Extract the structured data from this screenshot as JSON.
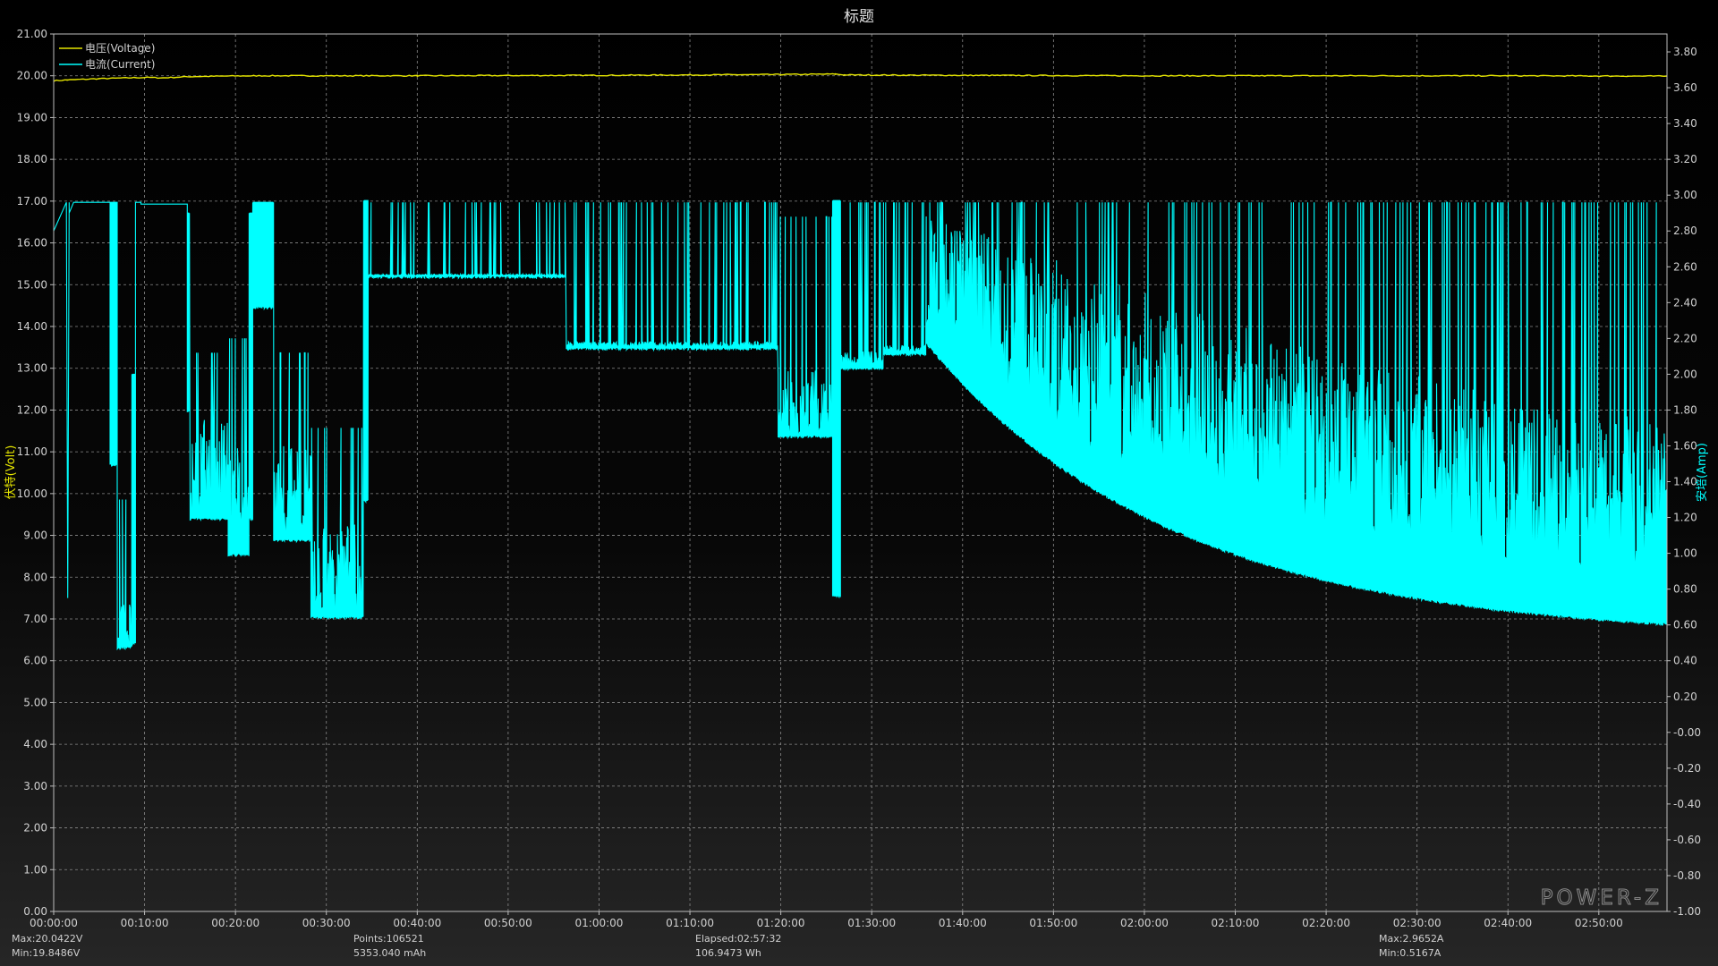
{
  "chart_data": {
    "type": "line",
    "title": "标题",
    "y_left_label": "伏特(Volt)",
    "y_right_label": "安培(Amp)",
    "y_left_range": [
      0,
      21
    ],
    "y_right_range": [
      -1.0,
      3.9
    ],
    "y_left_ticks": [
      "0.00",
      "1.00",
      "2.00",
      "3.00",
      "4.00",
      "5.00",
      "6.00",
      "7.00",
      "8.00",
      "9.00",
      "10.00",
      "11.00",
      "12.00",
      "13.00",
      "14.00",
      "15.00",
      "16.00",
      "17.00",
      "18.00",
      "19.00",
      "20.00",
      "21.00"
    ],
    "y_right_ticks": [
      "-1.00",
      "-0.80",
      "-0.60",
      "-0.40",
      "-0.20",
      "-0.00",
      "0.20",
      "0.40",
      "0.60",
      "0.80",
      "1.00",
      "1.20",
      "1.40",
      "1.60",
      "1.80",
      "2.00",
      "2.20",
      "2.40",
      "2.60",
      "2.80",
      "3.00",
      "3.20",
      "3.40",
      "3.60",
      "3.80"
    ],
    "x_ticks": [
      "00:00:00",
      "00:10:00",
      "00:20:00",
      "00:30:00",
      "00:40:00",
      "00:50:00",
      "01:00:00",
      "01:10:00",
      "01:20:00",
      "01:30:00",
      "01:40:00",
      "01:50:00",
      "02:00:00",
      "02:10:00",
      "02:20:00",
      "02:30:00",
      "02:40:00",
      "02:50:00"
    ],
    "x_range_minutes": [
      0,
      177.5
    ],
    "grid": true,
    "legend_position": "top-left",
    "series": [
      {
        "name": "电压(Voltage)",
        "axis": "left",
        "color": "#e6e600",
        "points": [
          [
            0,
            19.88
          ],
          [
            1.5,
            19.9
          ],
          [
            5,
            19.93
          ],
          [
            10,
            19.96
          ],
          [
            12,
            19.95
          ],
          [
            15,
            19.98
          ],
          [
            22,
            20.0
          ],
          [
            40,
            20.0
          ],
          [
            60,
            20.01
          ],
          [
            80,
            20.03
          ],
          [
            86,
            20.04
          ],
          [
            87,
            20.02
          ],
          [
            100,
            20.01
          ],
          [
            120,
            20.0
          ],
          [
            140,
            20.0
          ],
          [
            160,
            20.0
          ],
          [
            177.5,
            19.99
          ]
        ]
      },
      {
        "name": "电流(Current)",
        "axis": "right",
        "color": "#00ffff",
        "segments": [
          {
            "t0": 0,
            "t1": 1.4,
            "kind": "ramp",
            "v0": 2.8,
            "v1": 2.96
          },
          {
            "t0": 1.4,
            "t1": 1.7,
            "kind": "drop",
            "v0": 0.75
          },
          {
            "t0": 1.7,
            "t1": 2.2,
            "kind": "ramp",
            "v0": 2.9,
            "v1": 2.96
          },
          {
            "t0": 2.2,
            "t1": 6.2,
            "kind": "flat",
            "v": 2.96
          },
          {
            "t0": 6.2,
            "t1": 7,
            "kind": "band",
            "top": 2.96,
            "bot": 1.5,
            "spike": 0
          },
          {
            "t0": 7,
            "t1": 8.6,
            "kind": "band",
            "top": 1.3,
            "bot": 0.48,
            "spike": 0.3
          },
          {
            "t0": 8.6,
            "t1": 9.0,
            "kind": "band",
            "top": 2.0,
            "bot": 0.5,
            "spike": 0
          },
          {
            "t0": 9.0,
            "t1": 9.6,
            "kind": "flat",
            "v": 2.96
          },
          {
            "t0": 9.6,
            "t1": 14.7,
            "kind": "flat",
            "v": 2.95
          },
          {
            "t0": 14.7,
            "t1": 15.0,
            "kind": "band",
            "top": 2.9,
            "bot": 1.8,
            "spike": 0
          },
          {
            "t0": 15.0,
            "t1": 19.2,
            "kind": "band",
            "top": 2.12,
            "bot": 1.2,
            "spike": 0.6
          },
          {
            "t0": 19.2,
            "t1": 21.5,
            "kind": "band",
            "top": 2.2,
            "bot": 1.0,
            "spike": 0.5
          },
          {
            "t0": 21.5,
            "t1": 21.9,
            "kind": "band",
            "top": 2.9,
            "bot": 1.2,
            "spike": 0
          },
          {
            "t0": 21.9,
            "t1": 24.2,
            "kind": "band",
            "top": 2.96,
            "bot": 2.38,
            "spike": 0
          },
          {
            "t0": 24.2,
            "t1": 28.3,
            "kind": "band",
            "top": 2.12,
            "bot": 1.08,
            "spike": 0.5
          },
          {
            "t0": 28.3,
            "t1": 34.1,
            "kind": "band",
            "top": 1.7,
            "bot": 0.65,
            "spike": 0.5
          },
          {
            "t0": 34.1,
            "t1": 34.6,
            "kind": "band",
            "top": 2.97,
            "bot": 1.3,
            "spike": 0
          },
          {
            "t0": 34.6,
            "t1": 56.4,
            "kind": "band",
            "top": 2.96,
            "bot": 2.55,
            "spike": 0.02
          },
          {
            "t0": 56.4,
            "t1": 79.7,
            "kind": "band",
            "top": 2.96,
            "bot": 2.15,
            "spike": 0.04
          },
          {
            "t0": 79.7,
            "t1": 85.7,
            "kind": "band",
            "top": 2.88,
            "bot": 1.66,
            "spike": 0.3
          },
          {
            "t0": 85.7,
            "t1": 86.6,
            "kind": "band",
            "top": 2.97,
            "bot": 0.77,
            "spike": 0
          },
          {
            "t0": 86.6,
            "t1": 91.3,
            "kind": "band",
            "top": 2.96,
            "bot": 2.04,
            "spike": 0.1
          },
          {
            "t0": 91.3,
            "t1": 96.0,
            "kind": "band",
            "top": 2.96,
            "bot": 2.12,
            "spike": 0.05
          },
          {
            "t0": 96.0,
            "t1": 177.5,
            "kind": "decay",
            "top": 2.96,
            "bot_start": 2.18,
            "bot_end": 0.53,
            "spike": 0.9
          }
        ]
      }
    ]
  },
  "stats": {
    "voltage_max": "Max:20.0422V",
    "voltage_min": "Min:19.8486V",
    "points": "Points:106521",
    "capacity": "5353.040 mAh",
    "elapsed": "Elapsed:02:57:32",
    "energy": "106.9473 Wh",
    "current_max": "Max:2.9652A",
    "current_min": "Min:0.5167A"
  },
  "brand": "POWER-Z",
  "colors": {
    "grid": "#8a8a8a",
    "axis": "#bdbdbd",
    "voltage": "#e6e600",
    "current": "#00ffff",
    "text": "#d0d0d0"
  }
}
